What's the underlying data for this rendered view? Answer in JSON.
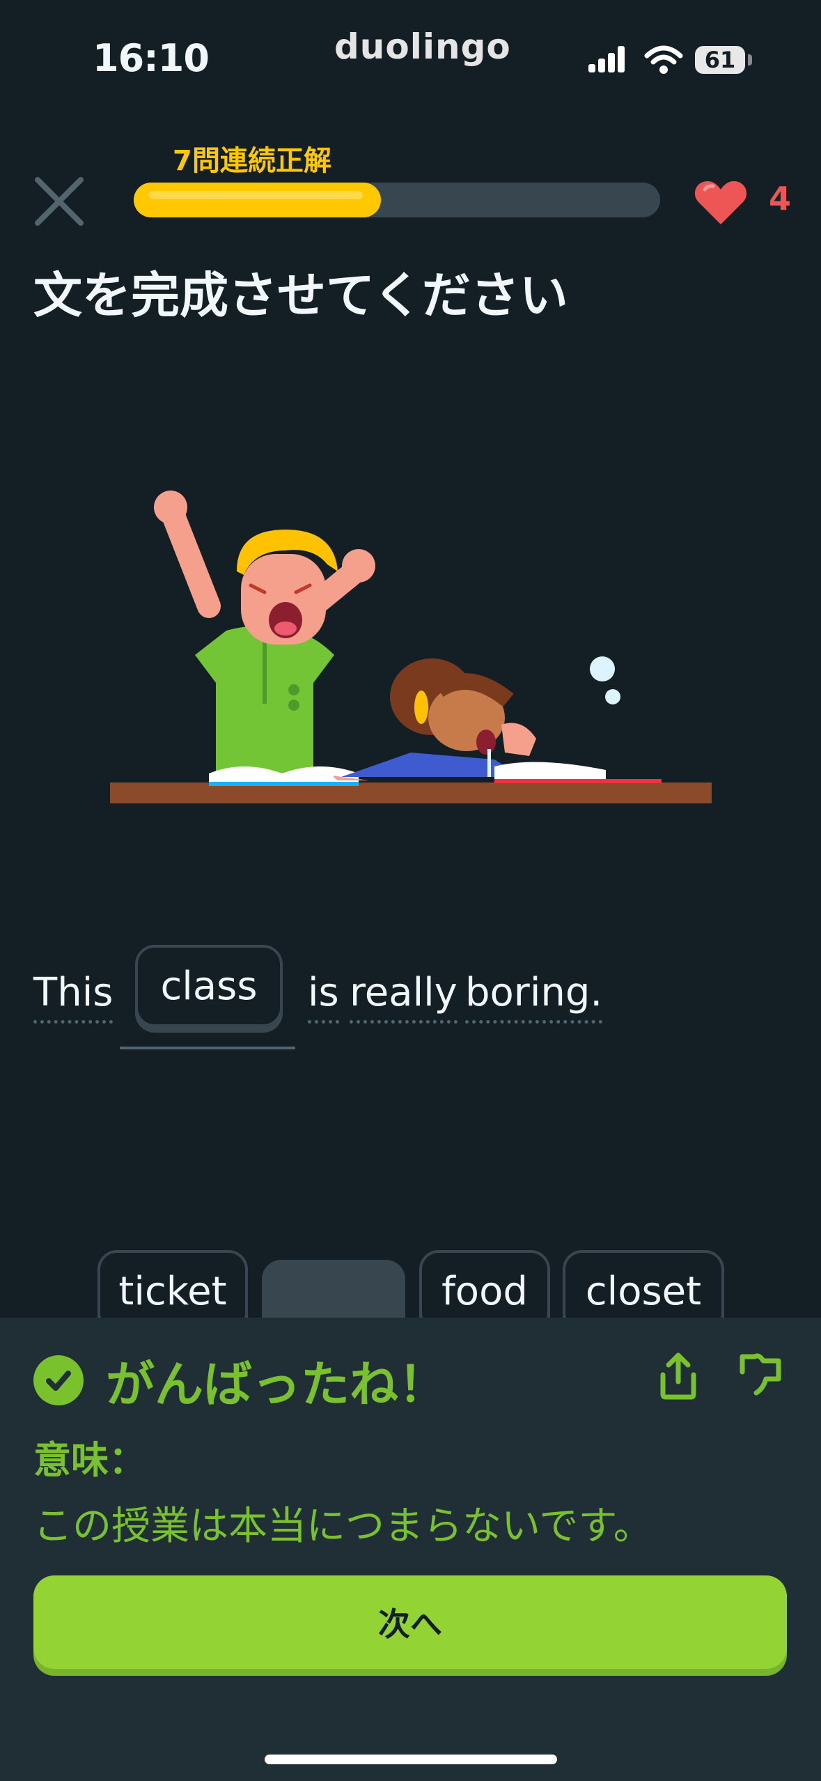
{
  "status_bar": {
    "time": "16:10",
    "brand": "duolingo",
    "battery": "61"
  },
  "lesson": {
    "streak_text": "7問連続正解",
    "progress": 0.47,
    "hearts": "4",
    "prompt": "文を完成させてください"
  },
  "sentence": {
    "word_before": "This",
    "selected_word": "class",
    "words_after": [
      "is",
      "really",
      "boring."
    ]
  },
  "word_bank": [
    "ticket",
    "food",
    "closet"
  ],
  "feedback": {
    "title": "がんばったね！",
    "meaning_label": "意味：",
    "translation": "この授業は本当につまらないです。",
    "next_label": "次へ"
  },
  "colors": {
    "background": "#131f24",
    "panel": "#202f36",
    "accent_green": "#79c22e",
    "button_green": "#93d333",
    "progress_yellow": "#ffc800",
    "heart_red": "#ee5555"
  },
  "icons": [
    "close-icon",
    "heart-icon",
    "check-icon",
    "share-icon",
    "flag-icon",
    "signal-icon",
    "wifi-icon",
    "battery-icon"
  ]
}
